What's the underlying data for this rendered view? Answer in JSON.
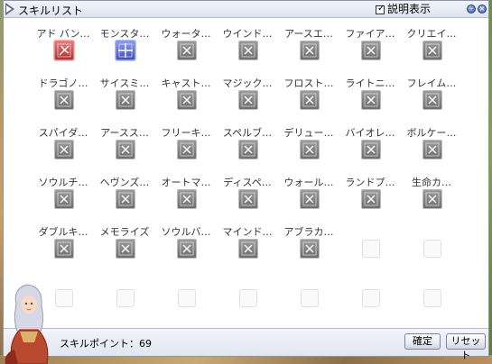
{
  "window": {
    "title": "スキルリスト",
    "show_description_label": "説明表示",
    "show_description_checked": true
  },
  "skills": [
    {
      "name": "アド バン…",
      "icon": "advanced-book-icon",
      "state": "red"
    },
    {
      "name": "モンスタ…",
      "icon": "monster-target-icon",
      "state": "blue"
    },
    {
      "name": "ウォータ…",
      "icon": "water-icon",
      "state": "gray"
    },
    {
      "name": "ウインド…",
      "icon": "wind-icon",
      "state": "gray"
    },
    {
      "name": "アースエ…",
      "icon": "earth-icon",
      "state": "gray"
    },
    {
      "name": "ファイア…",
      "icon": "fire-icon",
      "state": "gray"
    },
    {
      "name": "クリエイ…",
      "icon": "create-icon",
      "state": "gray"
    },
    {
      "name": "ドラゴノ…",
      "icon": "dragonology-icon",
      "state": "gray"
    },
    {
      "name": "サイスミ…",
      "icon": "seismic-icon",
      "state": "gray"
    },
    {
      "name": "キャスト…",
      "icon": "cast-icon",
      "state": "gray"
    },
    {
      "name": "マジック…",
      "icon": "magic-icon",
      "state": "gray"
    },
    {
      "name": "フロスト…",
      "icon": "frost-icon",
      "state": "gray"
    },
    {
      "name": "ライトニ…",
      "icon": "lightning-icon",
      "state": "gray"
    },
    {
      "name": "フレイム…",
      "icon": "flame-icon",
      "state": "gray"
    },
    {
      "name": "スパイダ…",
      "icon": "spider-web-icon",
      "state": "gray"
    },
    {
      "name": "アースス…",
      "icon": "earth-spike-icon",
      "state": "gray"
    },
    {
      "name": "フリーキ…",
      "icon": "free-cast-icon",
      "state": "gray"
    },
    {
      "name": "スペルブ…",
      "icon": "spell-breaker-icon",
      "state": "gray"
    },
    {
      "name": "デリュー…",
      "icon": "deluge-icon",
      "state": "gray"
    },
    {
      "name": "バイオレ…",
      "icon": "violent-gale-icon",
      "state": "gray"
    },
    {
      "name": "ボルケー…",
      "icon": "volcano-icon",
      "state": "gray"
    },
    {
      "name": "ソウルチ…",
      "icon": "soul-change-icon",
      "state": "gray"
    },
    {
      "name": "ヘヴンズ…",
      "icon": "heavens-drive-icon",
      "state": "gray"
    },
    {
      "name": "オートマ…",
      "icon": "auto-magic-icon",
      "state": "gray"
    },
    {
      "name": "ディスペ…",
      "icon": "dispell-icon",
      "state": "gray"
    },
    {
      "name": "ウォール…",
      "icon": "wall-icon",
      "state": "gray"
    },
    {
      "name": "ランドプ…",
      "icon": "land-protector-icon",
      "state": "gray"
    },
    {
      "name": "生命カ…",
      "icon": "life-icon",
      "state": "gray"
    },
    {
      "name": "ダブルキ…",
      "icon": "double-cast-icon",
      "state": "gray"
    },
    {
      "name": "メモライズ",
      "icon": "memorize-icon",
      "state": "gray"
    },
    {
      "name": "ソウルバ…",
      "icon": "soul-burn-icon",
      "state": "gray"
    },
    {
      "name": "マインド…",
      "icon": "mind-breaker-icon",
      "state": "gray"
    },
    {
      "name": "アブラカ…",
      "icon": "abracadabra-icon",
      "state": "gray"
    }
  ],
  "footer": {
    "points_label": "スキルポイント：69",
    "ok_label": "確定",
    "reset_label": "リセット"
  }
}
